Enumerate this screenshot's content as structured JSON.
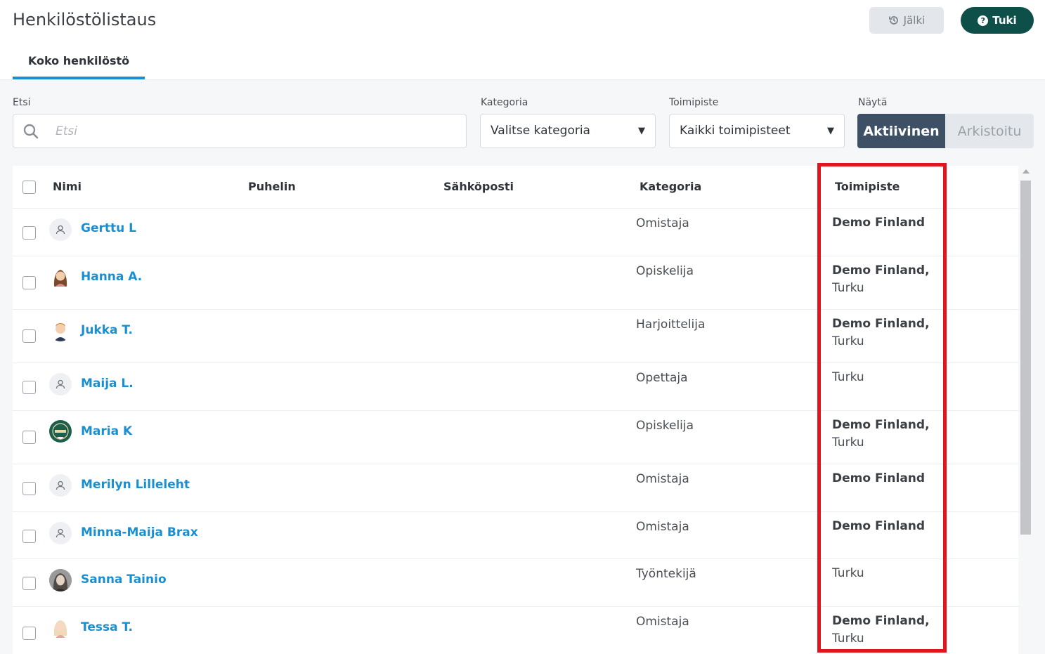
{
  "header": {
    "title": "Henkilöstölistaus",
    "back_label": "Jälki",
    "help_label": "Tuki"
  },
  "tabs": [
    {
      "label": "Koko henkilöstö"
    }
  ],
  "filters": {
    "search_label": "Etsi",
    "search_placeholder": "Etsi",
    "category_label": "Kategoria",
    "category_value": "Valitse kategoria",
    "location_label": "Toimipiste",
    "location_value": "Kaikki toimipisteet",
    "show_label": "Näytä",
    "show_active": "Aktiivinen",
    "show_archived": "Arkistoitu"
  },
  "table": {
    "columns": [
      "Nimi",
      "Puhelin",
      "Sähköposti",
      "Kategoria",
      "Toimipiste"
    ],
    "rows": [
      {
        "name": "Gerttu L",
        "category": "Omistaja",
        "location_bold": "Demo Finland",
        "location_rest": "",
        "avatar": "user-placeholder-icon"
      },
      {
        "name": "Hanna A.",
        "category": "Opiskelija",
        "location_bold": "Demo Finland,",
        "location_rest": "Turku",
        "avatar": "woman-avatar"
      },
      {
        "name": "Jukka T.",
        "category": "Harjoittelija",
        "location_bold": "Demo Finland,",
        "location_rest": "Turku",
        "avatar": "man-avatar"
      },
      {
        "name": "Maija L.",
        "category": "Opettaja",
        "location_bold": "",
        "location_rest": "Turku",
        "avatar": "user-placeholder-icon"
      },
      {
        "name": "Maria K",
        "category": "Opiskelija",
        "location_bold": "Demo Finland,",
        "location_rest": "Turku",
        "avatar": "badge-avatar"
      },
      {
        "name": "Merilyn Lilleleht",
        "category": "Omistaja",
        "location_bold": "Demo Finland",
        "location_rest": "",
        "avatar": "user-placeholder-icon"
      },
      {
        "name": "Minna-Maija Brax",
        "category": "Omistaja",
        "location_bold": "Demo Finland",
        "location_rest": "",
        "avatar": "user-placeholder-icon"
      },
      {
        "name": "Sanna Tainio",
        "category": "Työntekijä",
        "location_bold": "",
        "location_rest": "Turku",
        "avatar": "photo-avatar"
      },
      {
        "name": "Tessa T.",
        "category": "Omistaja",
        "location_bold": "Demo Finland,",
        "location_rest": "Turku",
        "avatar": "woman-avatar-blonde"
      }
    ]
  },
  "colors": {
    "accent": "#1a8fd0",
    "help_button": "#0e4f4a",
    "active_toggle": "#3d5066",
    "highlight": "#e0151d"
  }
}
